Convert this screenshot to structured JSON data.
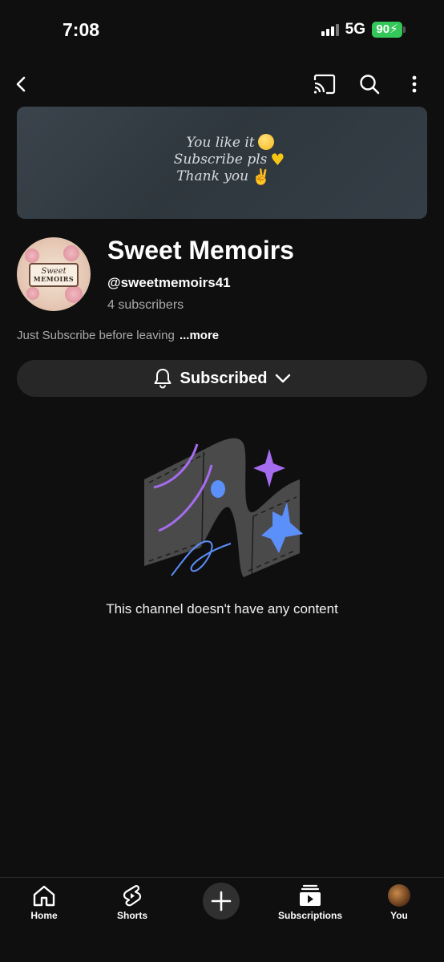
{
  "status_bar": {
    "time": "7:08",
    "network": "5G",
    "battery": "90"
  },
  "top_bar": {
    "icons": [
      "back-arrow-icon",
      "cast-icon",
      "search-icon",
      "more-vert-icon"
    ]
  },
  "banner": {
    "lines": [
      "You like it",
      "Subscribe pls",
      "Thank you"
    ]
  },
  "channel": {
    "name": "Sweet Memoirs",
    "handle": "@sweetmemoirs41",
    "subscribers": "4 subscribers",
    "description": "Just Subscribe before leaving",
    "more_label": "...more",
    "avatar_text_1": "Sweet",
    "avatar_text_2": "MEMOIRS"
  },
  "subscribe_button": {
    "label": "Subscribed"
  },
  "empty_state": {
    "message": "This channel doesn't have any content"
  },
  "bottom_nav": {
    "items": [
      {
        "label": "Home",
        "icon": "home-icon"
      },
      {
        "label": "Shorts",
        "icon": "shorts-icon"
      },
      {
        "label": "",
        "icon": "plus-icon"
      },
      {
        "label": "Subscriptions",
        "icon": "subscriptions-icon"
      },
      {
        "label": "You",
        "icon": "profile-avatar"
      }
    ]
  },
  "colors": {
    "background": "#0f0f0f",
    "surface": "#272727",
    "secondary_text": "#aaaaaa",
    "battery": "#34c759",
    "art_purple": "#a66cf0",
    "art_blue": "#5b8ff9"
  }
}
